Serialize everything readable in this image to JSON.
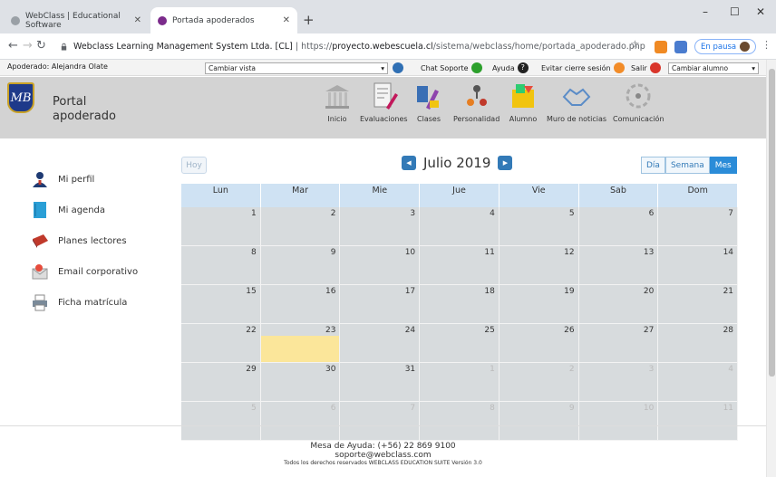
{
  "browser": {
    "tabs": [
      {
        "title": "WebClass | Educational Software",
        "active": false
      },
      {
        "title": "Portada apoderados",
        "active": true
      }
    ],
    "url_host": "Webclass Learning Management System Ltda. [CL]",
    "url_separator": "|",
    "url_prefix": "https://",
    "url_domain": "proyecto.webescuela.cl",
    "url_path": "/sistema/webclass/home/portada_apoderado.php",
    "pause_label": "En pausa"
  },
  "appbar": {
    "user_label": "Apoderado: Alejandra Olate",
    "view_select": "Cambiar vista",
    "chat": "Chat Soporte",
    "help": "Ayuda",
    "avoid_logout": "Evitar cierre sesión",
    "logout": "Salir",
    "student_select": "Cambiar alumno"
  },
  "header": {
    "logo_text": "MB",
    "title_line1": "Portal",
    "title_line2": "apoderado",
    "menu": [
      {
        "label": "Inicio"
      },
      {
        "label": "Evaluaciones"
      },
      {
        "label": "Clases"
      },
      {
        "label": "Personalidad"
      },
      {
        "label": "Alumno"
      },
      {
        "label": "Muro de noticias"
      },
      {
        "label": "Comunicación"
      }
    ]
  },
  "sidebar": {
    "items": [
      {
        "label": "Mi perfil"
      },
      {
        "label": "Mi agenda"
      },
      {
        "label": "Planes lectores"
      },
      {
        "label": "Email corporativo"
      },
      {
        "label": "Ficha matrícula"
      }
    ]
  },
  "calendar": {
    "today_button": "Hoy",
    "title": "Julio 2019",
    "views": [
      "Día",
      "Semana",
      "Mes"
    ],
    "active_view": "Mes",
    "weekdays": [
      "Lun",
      "Mar",
      "Mie",
      "Jue",
      "Vie",
      "Sab",
      "Dom"
    ],
    "weeks": [
      [
        "1",
        "2",
        "3",
        "4",
        "5",
        "6",
        "7"
      ],
      [
        "8",
        "9",
        "10",
        "11",
        "12",
        "13",
        "14"
      ],
      [
        "15",
        "16",
        "17",
        "18",
        "19",
        "20",
        "21"
      ],
      [
        "22",
        "23",
        "24",
        "25",
        "26",
        "27",
        "28"
      ],
      [
        "29",
        "30",
        "31",
        "1",
        "2",
        "3",
        "4"
      ],
      [
        "5",
        "6",
        "7",
        "8",
        "9",
        "10",
        "11"
      ]
    ],
    "today": "23"
  },
  "footer": {
    "help_desk": "Mesa de Ayuda: (+56) 22 869 9100",
    "email": "soporte@webclass.com",
    "rights": "Todos los derechos reservados WEBCLASS EDUCATION SUITE Versión 3.0"
  },
  "colors": {
    "header_bg": "#d3d3d3",
    "calendar_head": "#cfe2f3",
    "calendar_cell": "#d7dbdd",
    "today_highlight": "#fbe69a",
    "accent": "#2b8cd8"
  }
}
